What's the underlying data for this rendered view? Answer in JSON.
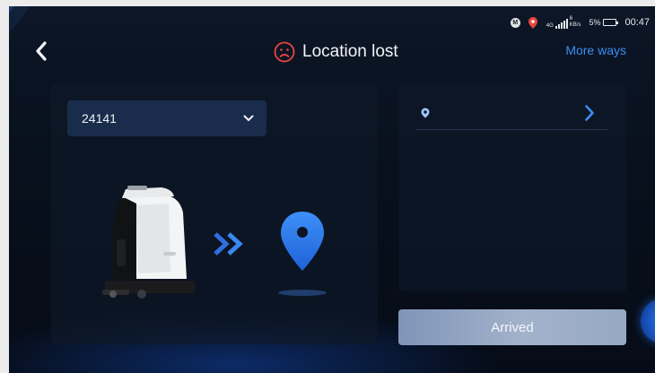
{
  "status_bar": {
    "badge_letter": "M",
    "network_type": "4G",
    "speed_value": "6",
    "speed_unit": "KB/s",
    "battery": "5%",
    "time": "00:47"
  },
  "header": {
    "title": "Location lost",
    "more_ways_label": "More ways"
  },
  "left_panel": {
    "dropdown_value": "24141"
  },
  "right_panel": {
    "location_text": ""
  },
  "arrived_button_label": "Arrived",
  "colors": {
    "accent": "#3c8df5",
    "sad_icon": "#e5473f",
    "pin": "#2f7ff0"
  },
  "icons": {
    "back": "chevron-left-icon",
    "status": "sad-face-icon",
    "dropdown": "chevron-down-icon",
    "location": "location-dot-icon",
    "go": "chevron-right-icon",
    "destination": "map-pin-icon",
    "direction": "double-chevron-right-icon"
  }
}
